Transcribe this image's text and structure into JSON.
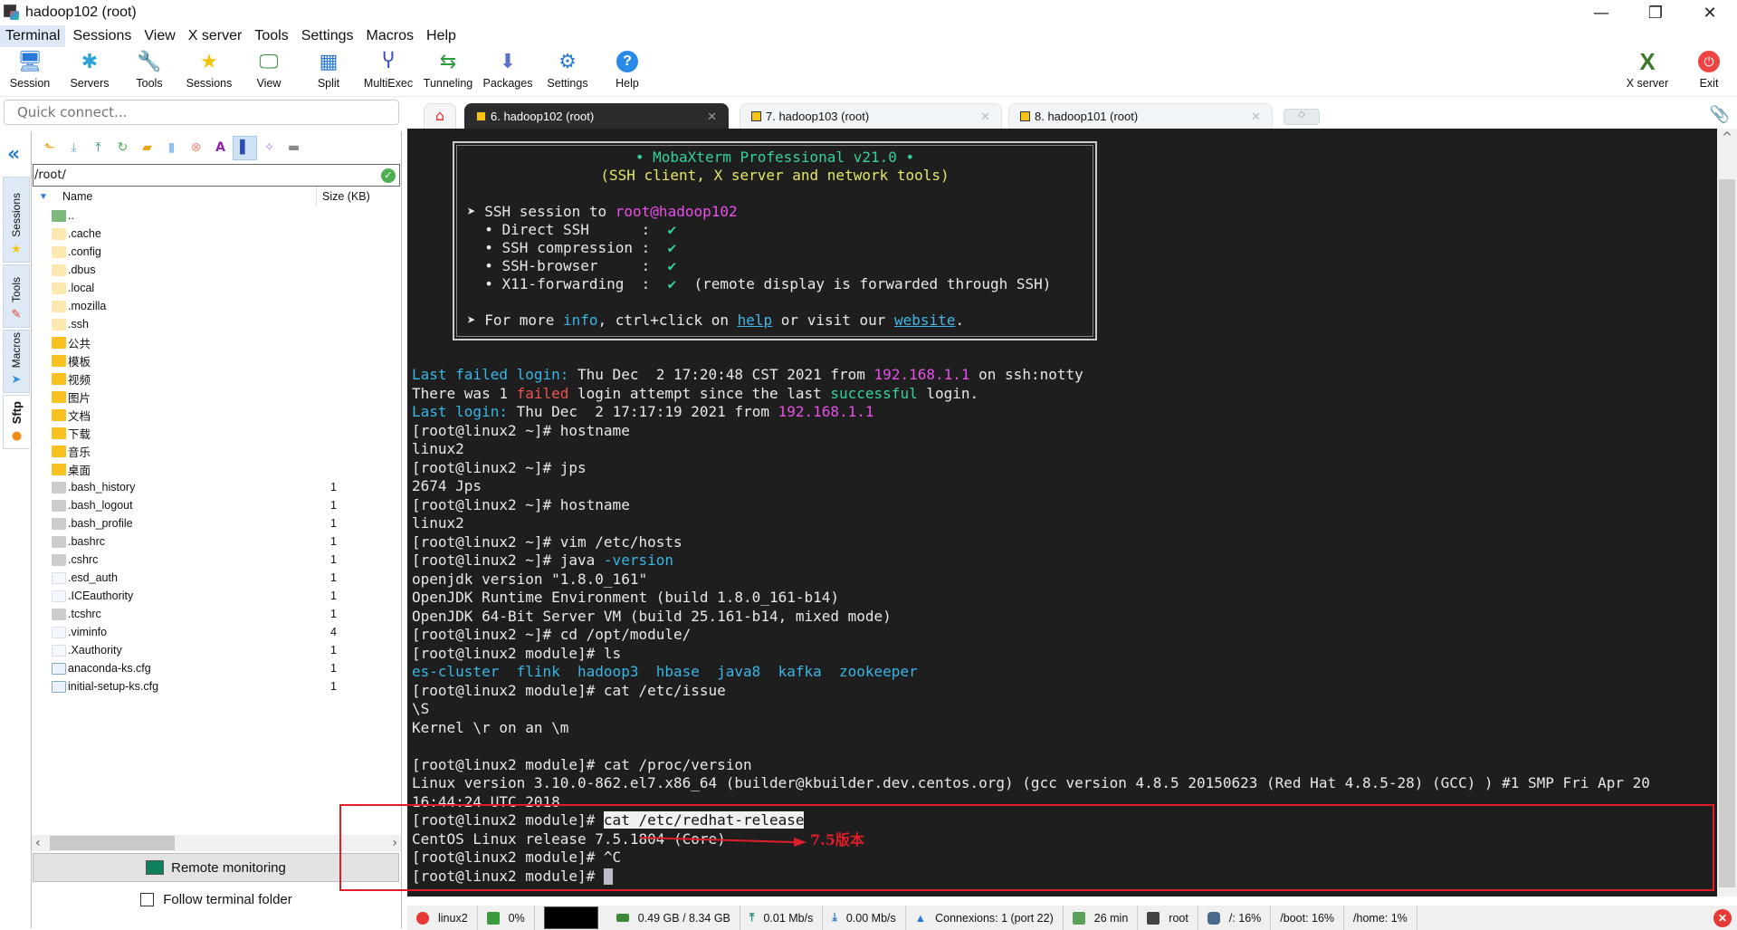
{
  "window": {
    "title": "hadoop102 (root)",
    "minimize": "—",
    "restore": "❐",
    "close": "✕"
  },
  "menu": [
    "Terminal",
    "Sessions",
    "View",
    "X server",
    "Tools",
    "Settings",
    "Macros",
    "Help"
  ],
  "toolbar": [
    {
      "label": "Session",
      "icon": "🖥"
    },
    {
      "label": "Servers",
      "icon": "✱"
    },
    {
      "label": "Tools",
      "icon": "🔧"
    },
    {
      "label": "Sessions",
      "icon": "★"
    },
    {
      "label": "View",
      "icon": "🖵"
    },
    {
      "label": "Split",
      "icon": "▦"
    },
    {
      "label": "MultiExec",
      "icon": "Ⴤ"
    },
    {
      "label": "Tunneling",
      "icon": "⇆"
    },
    {
      "label": "Packages",
      "icon": "⬇"
    },
    {
      "label": "Settings",
      "icon": "⚙"
    },
    {
      "label": "Help",
      "icon": "?"
    }
  ],
  "toolbar_right": [
    {
      "label": "X server",
      "icon": "X"
    },
    {
      "label": "Exit",
      "icon": "⏻"
    }
  ],
  "quick_connect": {
    "placeholder": "Quick connect..."
  },
  "side_tabs": [
    "Sessions",
    "Tools",
    "Macros",
    "Sftp"
  ],
  "sftp": {
    "path": "/root/",
    "columns": {
      "name": "Name",
      "size": "Size (KB)"
    },
    "files": [
      {
        "name": "..",
        "type": "up",
        "size": ""
      },
      {
        "name": ".cache",
        "type": "hid",
        "size": ""
      },
      {
        "name": ".config",
        "type": "hid",
        "size": ""
      },
      {
        "name": ".dbus",
        "type": "hid",
        "size": ""
      },
      {
        "name": ".local",
        "type": "hid",
        "size": ""
      },
      {
        "name": ".mozilla",
        "type": "hid",
        "size": ""
      },
      {
        "name": ".ssh",
        "type": "hid",
        "size": ""
      },
      {
        "name": "公共",
        "type": "dir",
        "size": ""
      },
      {
        "name": "模板",
        "type": "dir",
        "size": ""
      },
      {
        "name": "视频",
        "type": "dir",
        "size": ""
      },
      {
        "name": "图片",
        "type": "dir",
        "size": ""
      },
      {
        "name": "文档",
        "type": "dir",
        "size": ""
      },
      {
        "name": "下载",
        "type": "dir",
        "size": ""
      },
      {
        "name": "音乐",
        "type": "dir",
        "size": ""
      },
      {
        "name": "桌面",
        "type": "dir",
        "size": ""
      },
      {
        "name": ".bash_history",
        "type": "term",
        "size": "1"
      },
      {
        "name": ".bash_logout",
        "type": "term",
        "size": "1"
      },
      {
        "name": ".bash_profile",
        "type": "term",
        "size": "1"
      },
      {
        "name": ".bashrc",
        "type": "term",
        "size": "1"
      },
      {
        "name": ".cshrc",
        "type": "term",
        "size": "1"
      },
      {
        "name": ".esd_auth",
        "type": "doc",
        "size": "1"
      },
      {
        "name": ".ICEauthority",
        "type": "doc",
        "size": "1"
      },
      {
        "name": ".tcshrc",
        "type": "term",
        "size": "1"
      },
      {
        "name": ".viminfo",
        "type": "doc",
        "size": "4"
      },
      {
        "name": ".Xauthority",
        "type": "doc",
        "size": "1"
      },
      {
        "name": "anaconda-ks.cfg",
        "type": "cfg",
        "size": "1"
      },
      {
        "name": "initial-setup-ks.cfg",
        "type": "cfg",
        "size": "1"
      }
    ],
    "remote_monitoring": "Remote monitoring",
    "follow_folder": "Follow terminal folder"
  },
  "tabs": [
    {
      "label": "6. hadoop102 (root)",
      "active": true
    },
    {
      "label": "7. hadoop103 (root)",
      "active": false
    },
    {
      "label": "8. hadoop101 (root)",
      "active": false
    }
  ],
  "terminal": {
    "banner": {
      "title": "• MobaXterm Professional v21.0 •",
      "subtitle": "(SSH client, X server and network tools)",
      "session_prefix": "➤ SSH session to ",
      "session_host": "root@hadoop102",
      "features": [
        {
          "name": "  • Direct SSH      :  ",
          "check": "✔",
          "note": ""
        },
        {
          "name": "  • SSH compression :  ",
          "check": "✔",
          "note": ""
        },
        {
          "name": "  • SSH-browser     :  ",
          "check": "✔",
          "note": ""
        },
        {
          "name": "  • X11-forwarding  :  ",
          "check": "✔",
          "note": "  (remote display is forwarded through SSH)"
        }
      ],
      "more": [
        "➤ For more ",
        "info",
        ", ctrl+click on ",
        "help",
        " or visit our ",
        "website",
        "."
      ]
    },
    "lines": [
      [
        {
          "t": "Last failed login:",
          "c": "cyan"
        },
        {
          "t": " Thu Dec  2 17:20:48 CST 2021 from "
        },
        {
          "t": "192.168.1.1",
          "c": "mag"
        },
        {
          "t": " on ssh:notty"
        }
      ],
      [
        {
          "t": "There was 1 "
        },
        {
          "t": "failed",
          "c": "red"
        },
        {
          "t": " login attempt since the last "
        },
        {
          "t": "successful",
          "c": "green"
        },
        {
          "t": " login."
        }
      ],
      [
        {
          "t": "Last login:",
          "c": "cyan"
        },
        {
          "t": " Thu Dec  2 17:17:19 2021 from "
        },
        {
          "t": "192.168.1.1",
          "c": "mag"
        }
      ],
      [
        {
          "t": "[root@linux2 ~]# hostname"
        }
      ],
      [
        {
          "t": "linux2"
        }
      ],
      [
        {
          "t": "[root@linux2 ~]# jps"
        }
      ],
      [
        {
          "t": "2674 Jps"
        }
      ],
      [
        {
          "t": "[root@linux2 ~]# hostname"
        }
      ],
      [
        {
          "t": "linux2"
        }
      ],
      [
        {
          "t": "[root@linux2 ~]# vim /etc/hosts"
        }
      ],
      [
        {
          "t": "[root@linux2 ~]# java "
        },
        {
          "t": "-version",
          "c": "cyan"
        }
      ],
      [
        {
          "t": "openjdk version \"1.8.0_161\""
        }
      ],
      [
        {
          "t": "OpenJDK Runtime Environment (build 1.8.0_161-b14)"
        }
      ],
      [
        {
          "t": "OpenJDK 64-Bit Server VM (build 25.161-b14, mixed mode)"
        }
      ],
      [
        {
          "t": "[root@linux2 ~]# cd /opt/module/"
        }
      ],
      [
        {
          "t": "[root@linux2 module]# ls"
        }
      ],
      [
        {
          "t": "es-cluster  flink  hadoop3  hbase  java8  kafka  zookeeper",
          "c": "cyan"
        }
      ],
      [
        {
          "t": "[root@linux2 module]# cat /etc/issue"
        }
      ],
      [
        {
          "t": "\\S"
        }
      ],
      [
        {
          "t": "Kernel \\r on an \\m"
        }
      ],
      [
        {
          "t": ""
        }
      ],
      [
        {
          "t": "[root@linux2 module]# cat /proc/version"
        }
      ],
      [
        {
          "t": "Linux version 3.10.0-862.el7.x86_64 (builder@kbuilder.dev.centos.org) (gcc version 4.8.5 20150623 (Red Hat 4.8.5-28) (GCC) ) #1 SMP Fri Apr 20"
        }
      ],
      [
        {
          "t": "16:44:24 UTC 2018"
        }
      ],
      [
        {
          "t": "[root@linux2 module]# "
        },
        {
          "t": "cat /etc/redhat-release",
          "c": "hl"
        }
      ],
      [
        {
          "t": "CentOS Linux release 7.5.1804 (Core)"
        }
      ],
      [
        {
          "t": "[root@linux2 module]# ^C"
        }
      ],
      [
        {
          "t": "[root@linux2 module]# "
        },
        {
          "t": "",
          "c": "cursor"
        }
      ]
    ],
    "annotation": "7.5版本"
  },
  "status": {
    "host": "linux2",
    "cpu": "0%",
    "memory": "0.49 GB / 8.34 GB",
    "upload": "0.01 Mb/s",
    "download": "0.00 Mb/s",
    "connections": "Connexions: 1 (port 22)",
    "uptime": "26 min",
    "user": "root",
    "disk_root": "/: 16%",
    "disk_boot": "/boot: 16%",
    "disk_home": "/home: 1%"
  }
}
